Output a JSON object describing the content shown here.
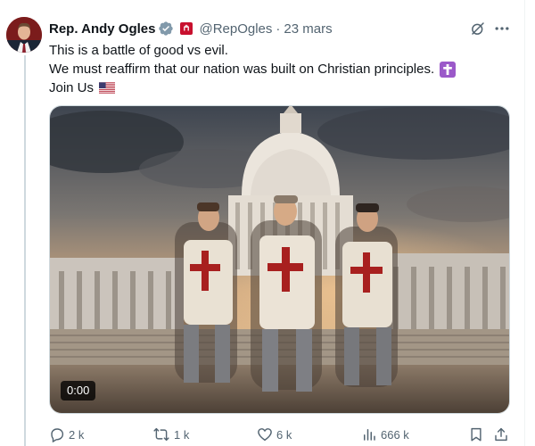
{
  "author": {
    "name": "Rep. Andy Ogles",
    "handle": "@RepOgles",
    "separator": "·",
    "date": "23 mars"
  },
  "tweet": {
    "lines": [
      "This is a battle of good vs evil.",
      "We must reaffirm that our nation was built on Christian principles.",
      "Join Us"
    ],
    "emojis": [
      "latin-cross-emoji",
      "us-flag-emoji"
    ]
  },
  "media": {
    "type": "video",
    "timestamp": "0:00"
  },
  "actions": {
    "replies": "2 k",
    "reposts": "1 k",
    "likes": "6 k",
    "views": "666 k"
  },
  "colors": {
    "text": "#0f1419",
    "secondary": "#536471",
    "verified": "#829aab",
    "cross_emoji_bg": "#9b59c9",
    "affiliation_badge": "#c8102e",
    "thread_line": "#cfd9de"
  }
}
